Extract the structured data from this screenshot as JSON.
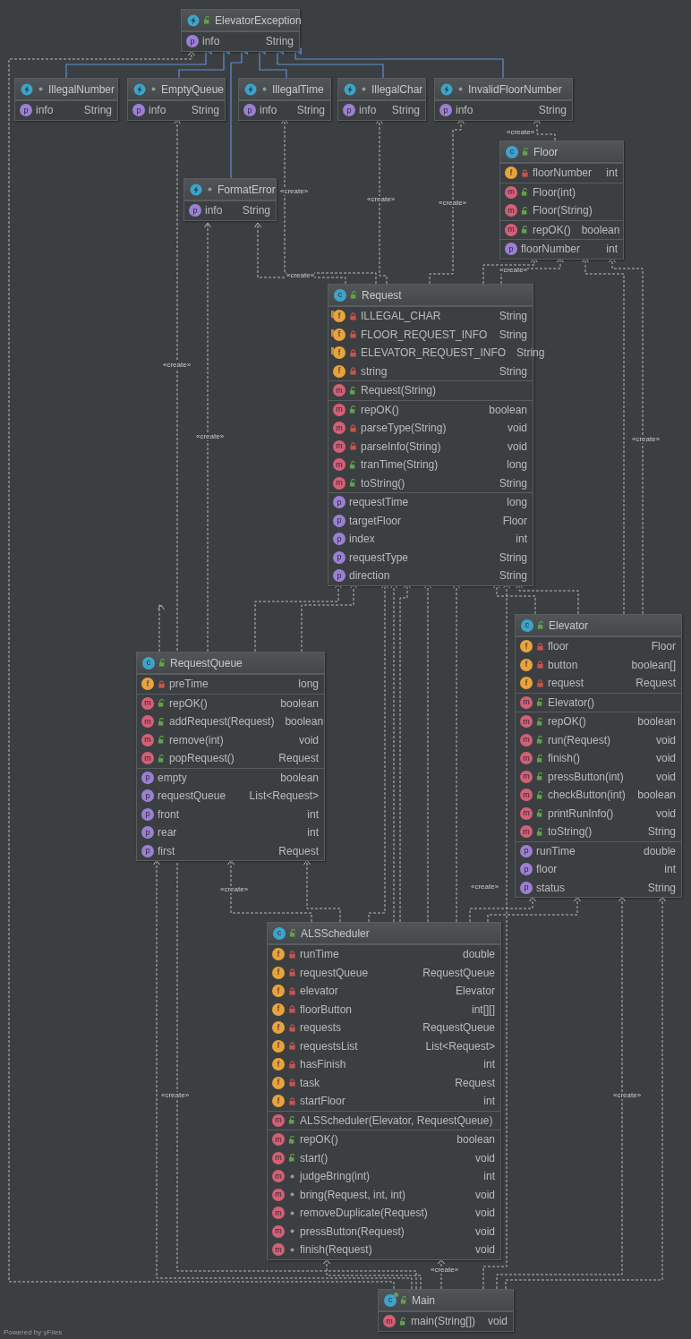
{
  "classes": [
    {
      "name": "ElevatorException",
      "kind": "exception",
      "public": true,
      "package": false,
      "sections": [
        [
          {
            "kind": "property",
            "badge": "p",
            "public": false,
            "private": false,
            "package": false,
            "name": "info",
            "type": "String"
          }
        ]
      ]
    },
    {
      "name": "IllegalNumber",
      "kind": "exception",
      "public": false,
      "package": true,
      "sections": [
        [
          {
            "kind": "property",
            "badge": "p",
            "public": false,
            "private": false,
            "package": false,
            "name": "info",
            "type": "String"
          }
        ]
      ]
    },
    {
      "name": "EmptyQueue",
      "kind": "exception",
      "public": false,
      "package": true,
      "sections": [
        [
          {
            "kind": "property",
            "badge": "p",
            "public": false,
            "private": false,
            "package": false,
            "name": "info",
            "type": "String"
          }
        ]
      ]
    },
    {
      "name": "IllegalTime",
      "kind": "exception",
      "public": false,
      "package": true,
      "sections": [
        [
          {
            "kind": "property",
            "badge": "p",
            "public": false,
            "private": false,
            "package": false,
            "name": "info",
            "type": "String"
          }
        ]
      ]
    },
    {
      "name": "IllegalChar",
      "kind": "exception",
      "public": false,
      "package": true,
      "sections": [
        [
          {
            "kind": "property",
            "badge": "p",
            "public": false,
            "private": false,
            "package": false,
            "name": "info",
            "type": "String"
          }
        ]
      ]
    },
    {
      "name": "InvalidFloorNumber",
      "kind": "exception",
      "public": false,
      "package": true,
      "sections": [
        [
          {
            "kind": "property",
            "badge": "p",
            "public": false,
            "private": false,
            "package": false,
            "name": "info",
            "type": "String"
          }
        ]
      ]
    },
    {
      "name": "FormatError",
      "kind": "exception",
      "public": false,
      "package": true,
      "sections": [
        [
          {
            "kind": "property",
            "badge": "p",
            "public": false,
            "private": false,
            "package": false,
            "name": "info",
            "type": "String"
          }
        ]
      ]
    },
    {
      "name": "Floor",
      "kind": "class",
      "badge": "c",
      "public": true,
      "package": false,
      "sections": [
        [
          {
            "kind": "field",
            "badge": "f",
            "public": false,
            "private": true,
            "package": false,
            "name": "floorNumber",
            "type": "int"
          }
        ],
        [
          {
            "kind": "method",
            "badge": "m",
            "public": true,
            "private": false,
            "package": false,
            "name": "Floor(int)"
          },
          {
            "kind": "method",
            "badge": "m",
            "public": true,
            "private": false,
            "package": false,
            "name": "Floor(String)"
          }
        ],
        [
          {
            "kind": "method",
            "badge": "m",
            "public": true,
            "private": false,
            "package": false,
            "name": "repOK()",
            "type": "boolean"
          }
        ],
        [
          {
            "kind": "property",
            "badge": "p",
            "public": false,
            "private": false,
            "package": false,
            "name": "floorNumber",
            "type": "int"
          }
        ]
      ]
    },
    {
      "name": "Request",
      "kind": "class",
      "badge": "c",
      "public": true,
      "package": false,
      "sections": [
        [
          {
            "kind": "static-field",
            "badge": "f",
            "public": false,
            "private": true,
            "package": false,
            "name": "ILLEGAL_CHAR",
            "type": "String"
          },
          {
            "kind": "static-field",
            "badge": "f",
            "public": false,
            "private": true,
            "package": false,
            "name": "FLOOR_REQUEST_INFO",
            "type": "String"
          },
          {
            "kind": "static-field",
            "badge": "f",
            "public": false,
            "private": true,
            "package": false,
            "name": "ELEVATOR_REQUEST_INFO",
            "type": "String"
          },
          {
            "kind": "field",
            "badge": "f",
            "public": false,
            "private": true,
            "package": false,
            "name": "string",
            "type": "String"
          }
        ],
        [
          {
            "kind": "method",
            "badge": "m",
            "public": true,
            "private": false,
            "package": false,
            "name": "Request(String)"
          }
        ],
        [
          {
            "kind": "method",
            "badge": "m",
            "public": true,
            "private": false,
            "package": false,
            "name": "repOK()",
            "type": "boolean"
          },
          {
            "kind": "method",
            "badge": "m",
            "public": false,
            "private": true,
            "package": false,
            "name": "parseType(String)",
            "type": "void"
          },
          {
            "kind": "method",
            "badge": "m",
            "public": false,
            "private": true,
            "package": false,
            "name": "parseInfo(String)",
            "type": "void"
          },
          {
            "kind": "method",
            "badge": "m",
            "public": true,
            "private": false,
            "package": false,
            "name": "tranTime(String)",
            "type": "long"
          },
          {
            "kind": "method",
            "badge": "m",
            "public": true,
            "private": false,
            "package": false,
            "name": "toString()",
            "type": "String"
          }
        ],
        [
          {
            "kind": "property",
            "badge": "p",
            "public": false,
            "private": false,
            "package": false,
            "name": "requestTime",
            "type": "long"
          },
          {
            "kind": "property",
            "badge": "p",
            "public": false,
            "private": false,
            "package": false,
            "name": "targetFloor",
            "type": "Floor"
          },
          {
            "kind": "property",
            "badge": "p",
            "public": false,
            "private": false,
            "package": false,
            "name": "index",
            "type": "int"
          },
          {
            "kind": "property",
            "badge": "p",
            "public": false,
            "private": false,
            "package": false,
            "name": "requestType",
            "type": "String"
          },
          {
            "kind": "property",
            "badge": "p",
            "public": false,
            "private": false,
            "package": false,
            "name": "direction",
            "type": "String"
          }
        ]
      ]
    },
    {
      "name": "RequestQueue",
      "kind": "class",
      "badge": "c",
      "public": true,
      "package": false,
      "sections": [
        [
          {
            "kind": "field",
            "badge": "f",
            "public": false,
            "private": true,
            "package": false,
            "name": "preTime",
            "type": "long"
          }
        ],
        [
          {
            "kind": "method",
            "badge": "m",
            "public": true,
            "private": false,
            "package": false,
            "name": "repOK()",
            "type": "boolean"
          },
          {
            "kind": "method",
            "badge": "m",
            "public": true,
            "private": false,
            "package": false,
            "name": "addRequest(Request)",
            "type": "boolean"
          },
          {
            "kind": "method",
            "badge": "m",
            "public": true,
            "private": false,
            "package": false,
            "name": "remove(int)",
            "type": "void"
          },
          {
            "kind": "method",
            "badge": "m",
            "public": true,
            "private": false,
            "package": false,
            "name": "popRequest()",
            "type": "Request"
          }
        ],
        [
          {
            "kind": "property",
            "badge": "p",
            "public": false,
            "private": false,
            "package": false,
            "name": "empty",
            "type": "boolean"
          },
          {
            "kind": "property",
            "badge": "p",
            "public": false,
            "private": false,
            "package": false,
            "name": "requestQueue",
            "type": "List<Request>"
          },
          {
            "kind": "property",
            "badge": "p",
            "public": false,
            "private": false,
            "package": false,
            "name": "front",
            "type": "int"
          },
          {
            "kind": "property",
            "badge": "p",
            "public": false,
            "private": false,
            "package": false,
            "name": "rear",
            "type": "int"
          },
          {
            "kind": "property",
            "badge": "p",
            "public": false,
            "private": false,
            "package": false,
            "name": "first",
            "type": "Request"
          }
        ]
      ]
    },
    {
      "name": "Elevator",
      "kind": "class",
      "badge": "c",
      "public": true,
      "package": false,
      "sections": [
        [
          {
            "kind": "field",
            "badge": "f",
            "public": false,
            "private": true,
            "package": false,
            "name": "floor",
            "type": "Floor"
          },
          {
            "kind": "field",
            "badge": "f",
            "public": false,
            "private": true,
            "package": false,
            "name": "button",
            "type": "boolean[]"
          },
          {
            "kind": "field",
            "badge": "f",
            "public": false,
            "private": true,
            "package": false,
            "name": "request",
            "type": "Request"
          }
        ],
        [
          {
            "kind": "method",
            "badge": "m",
            "public": true,
            "private": false,
            "package": false,
            "name": "Elevator()"
          }
        ],
        [
          {
            "kind": "method",
            "badge": "m",
            "public": true,
            "private": false,
            "package": false,
            "name": "repOK()",
            "type": "boolean"
          },
          {
            "kind": "method",
            "badge": "m",
            "public": true,
            "private": false,
            "package": false,
            "name": "run(Request)",
            "type": "void"
          },
          {
            "kind": "method",
            "badge": "m",
            "public": true,
            "private": false,
            "package": false,
            "name": "finish()",
            "type": "void"
          },
          {
            "kind": "method",
            "badge": "m",
            "public": true,
            "private": false,
            "package": false,
            "name": "pressButton(int)",
            "type": "void"
          },
          {
            "kind": "method",
            "badge": "m",
            "public": true,
            "private": false,
            "package": false,
            "name": "checkButton(int)",
            "type": "boolean"
          },
          {
            "kind": "method",
            "badge": "m",
            "public": true,
            "private": false,
            "package": false,
            "name": "printRunInfo()",
            "type": "void"
          },
          {
            "kind": "method",
            "badge": "m",
            "public": true,
            "private": false,
            "package": false,
            "name": "toString()",
            "type": "String"
          }
        ],
        [
          {
            "kind": "property",
            "badge": "p",
            "public": false,
            "private": false,
            "package": false,
            "name": "runTime",
            "type": "double"
          },
          {
            "kind": "property",
            "badge": "p",
            "public": false,
            "private": false,
            "package": false,
            "name": "floor",
            "type": "int"
          },
          {
            "kind": "property",
            "badge": "p",
            "public": false,
            "private": false,
            "package": false,
            "name": "status",
            "type": "String"
          }
        ]
      ]
    },
    {
      "name": "ALSScheduler",
      "kind": "class",
      "badge": "c",
      "public": true,
      "package": false,
      "sections": [
        [
          {
            "kind": "field",
            "badge": "f",
            "public": false,
            "private": true,
            "package": false,
            "name": "runTime",
            "type": "double"
          },
          {
            "kind": "field",
            "badge": "f",
            "public": false,
            "private": true,
            "package": false,
            "name": "requestQueue",
            "type": "RequestQueue"
          },
          {
            "kind": "field",
            "badge": "f",
            "public": false,
            "private": true,
            "package": false,
            "name": "elevator",
            "type": "Elevator"
          },
          {
            "kind": "field",
            "badge": "f",
            "public": false,
            "private": true,
            "package": false,
            "name": "floorButton",
            "type": "int[][]"
          },
          {
            "kind": "field",
            "badge": "f",
            "public": false,
            "private": true,
            "package": false,
            "name": "requests",
            "type": "RequestQueue"
          },
          {
            "kind": "field",
            "badge": "f",
            "public": false,
            "private": true,
            "package": false,
            "name": "requestsList",
            "type": "List<Request>"
          },
          {
            "kind": "field",
            "badge": "f",
            "public": false,
            "private": true,
            "package": false,
            "name": "hasFinish",
            "type": "int"
          },
          {
            "kind": "field",
            "badge": "f",
            "public": false,
            "private": true,
            "package": false,
            "name": "task",
            "type": "Request"
          },
          {
            "kind": "field",
            "badge": "f",
            "public": false,
            "private": true,
            "package": false,
            "name": "startFloor",
            "type": "int"
          }
        ],
        [
          {
            "kind": "method",
            "badge": "m",
            "public": true,
            "private": false,
            "package": false,
            "name": "ALSScheduler(Elevator, RequestQueue)"
          }
        ],
        [
          {
            "kind": "method",
            "badge": "m",
            "public": true,
            "private": false,
            "package": false,
            "name": "repOK()",
            "type": "boolean"
          },
          {
            "kind": "method",
            "badge": "m",
            "public": true,
            "private": false,
            "package": false,
            "name": "start()",
            "type": "void"
          },
          {
            "kind": "method",
            "badge": "m",
            "public": false,
            "private": false,
            "package": true,
            "name": "judgeBring(int)",
            "type": "int"
          },
          {
            "kind": "method",
            "badge": "m",
            "public": false,
            "private": false,
            "package": true,
            "name": "bring(Request, int, int)",
            "type": "void"
          },
          {
            "kind": "method",
            "badge": "m",
            "public": false,
            "private": false,
            "package": true,
            "name": "removeDuplicate(Request)",
            "type": "void"
          },
          {
            "kind": "method",
            "badge": "m",
            "public": false,
            "private": false,
            "package": true,
            "name": "pressButton(Request)",
            "type": "void"
          },
          {
            "kind": "method",
            "badge": "m",
            "public": false,
            "private": false,
            "package": true,
            "name": "finish(Request)",
            "type": "void"
          }
        ]
      ]
    },
    {
      "name": "Main",
      "kind": "main-class",
      "badge": "c",
      "public": true,
      "package": false,
      "sections": [
        [
          {
            "kind": "main-method",
            "badge": "m",
            "public": true,
            "private": false,
            "package": false,
            "name": "main(String[])",
            "type": "void"
          }
        ]
      ]
    }
  ],
  "edge_labels": [
    "«create»",
    "«create»",
    "«create»",
    "«create»",
    "«create»",
    "«create»",
    "«create»",
    "«create»",
    "«create»",
    "«create»",
    "«create»",
    "«create»",
    "«create»",
    "«create»"
  ],
  "footer": "Powered by yFiles"
}
